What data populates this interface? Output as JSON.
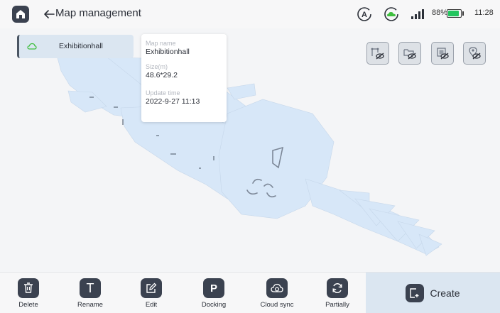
{
  "header": {
    "title": "Map management",
    "battery_percent": "88%",
    "battery_level": 0.88,
    "time": "11:28"
  },
  "map_list": {
    "selected_map": "Exhibitionhall"
  },
  "info_popup": {
    "map_name_label": "Map name",
    "map_name_value": "Exhibitionhall",
    "size_label": "Size(m)",
    "size_value": "48.6*29.2",
    "update_label": "Update time",
    "update_value": "2022-9-27 11:13"
  },
  "layer_toggles": [
    {
      "icon": "path-hidden-icon"
    },
    {
      "icon": "folder-hidden-icon"
    },
    {
      "icon": "grid-hidden-icon"
    },
    {
      "icon": "location-hidden-icon"
    }
  ],
  "toolbar": {
    "delete_label": "Delete",
    "rename_label": "Rename",
    "edit_label": "Edit",
    "docking_label": "Docking",
    "cloud_sync_label": "Cloud sync",
    "partially_label": "Partially",
    "create_label": "Create",
    "rename_glyph": "T",
    "docking_glyph": "P"
  },
  "colors": {
    "accent_dark": "#3b4250",
    "panel_blue": "#dbe6f1",
    "map_fill": "#d7e7f8",
    "battery_green": "#22c55e",
    "cloud_green": "#3fbf3f"
  }
}
